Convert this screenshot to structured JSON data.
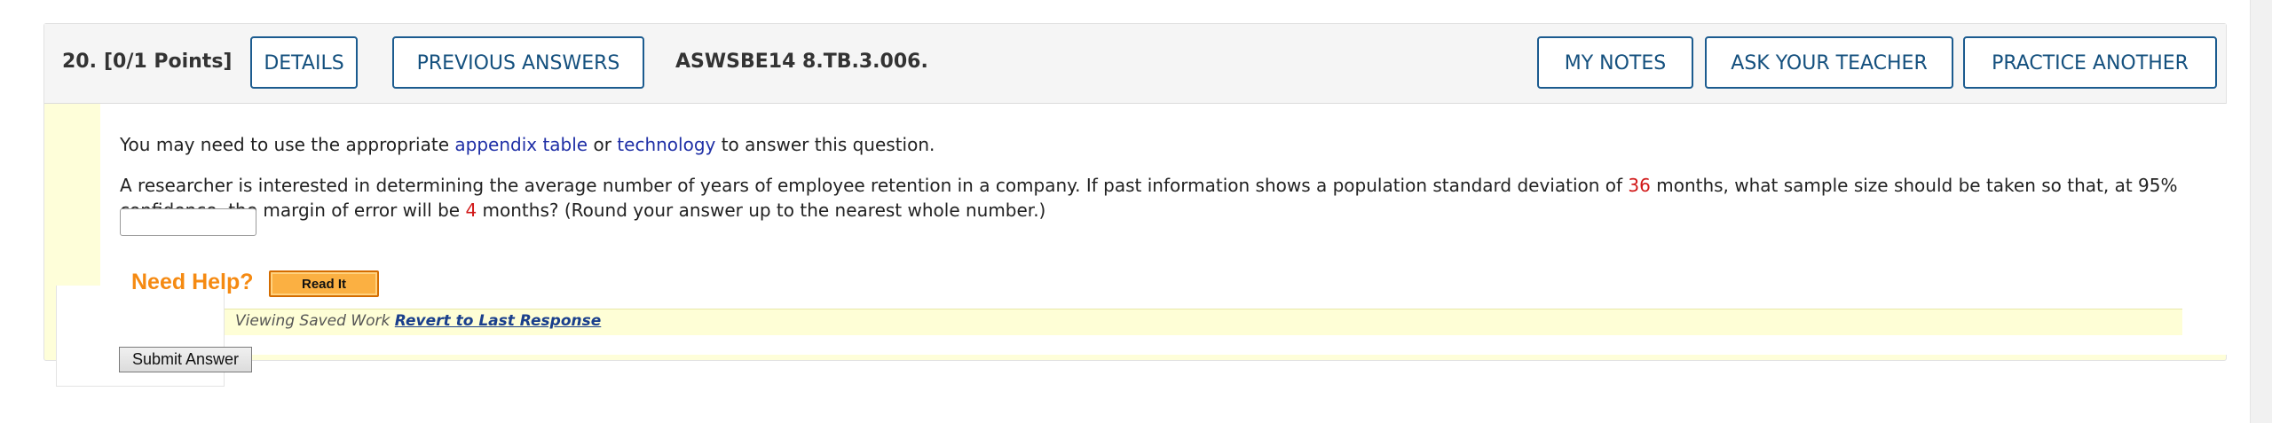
{
  "question": {
    "number": "20.",
    "points": "[0/1 Points]",
    "code": "ASWSBE14 8.TB.3.006."
  },
  "buttons": {
    "details": "DETAILS",
    "previous_answers": "PREVIOUS ANSWERS",
    "my_notes": "MY NOTES",
    "ask_your_teacher": "ASK YOUR TEACHER",
    "practice_another": "PRACTICE ANOTHER",
    "read_it": "Read It",
    "submit_answer": "Submit Answer"
  },
  "intro": {
    "before": "You may need to use the appropriate",
    "link1": "appendix table",
    "middle": "or",
    "link2": "technology",
    "after": "to answer this question."
  },
  "prompt": {
    "line1_before": "A researcher is interested in determining the average number of years of employee retention in a company. If past information shows a population standard deviation of",
    "std_dev_value": "36",
    "line1_after": "months, what sample size should be taken so that, at 95%",
    "line2_before": "confidence, the margin of error will be",
    "margin_value": "4",
    "line2_after": "months? (Round your answer up to the nearest whole number.)"
  },
  "answer": {
    "value": "",
    "placeholder": ""
  },
  "help": {
    "label": "Need Help?"
  },
  "saved": {
    "text": "Viewing Saved Work",
    "link": "Revert to Last Response"
  },
  "colors": {
    "accent": "#1b5b8f",
    "highlight_red": "#d11919",
    "help_orange": "#f58a12",
    "link_blue": "#1f2fa6"
  }
}
